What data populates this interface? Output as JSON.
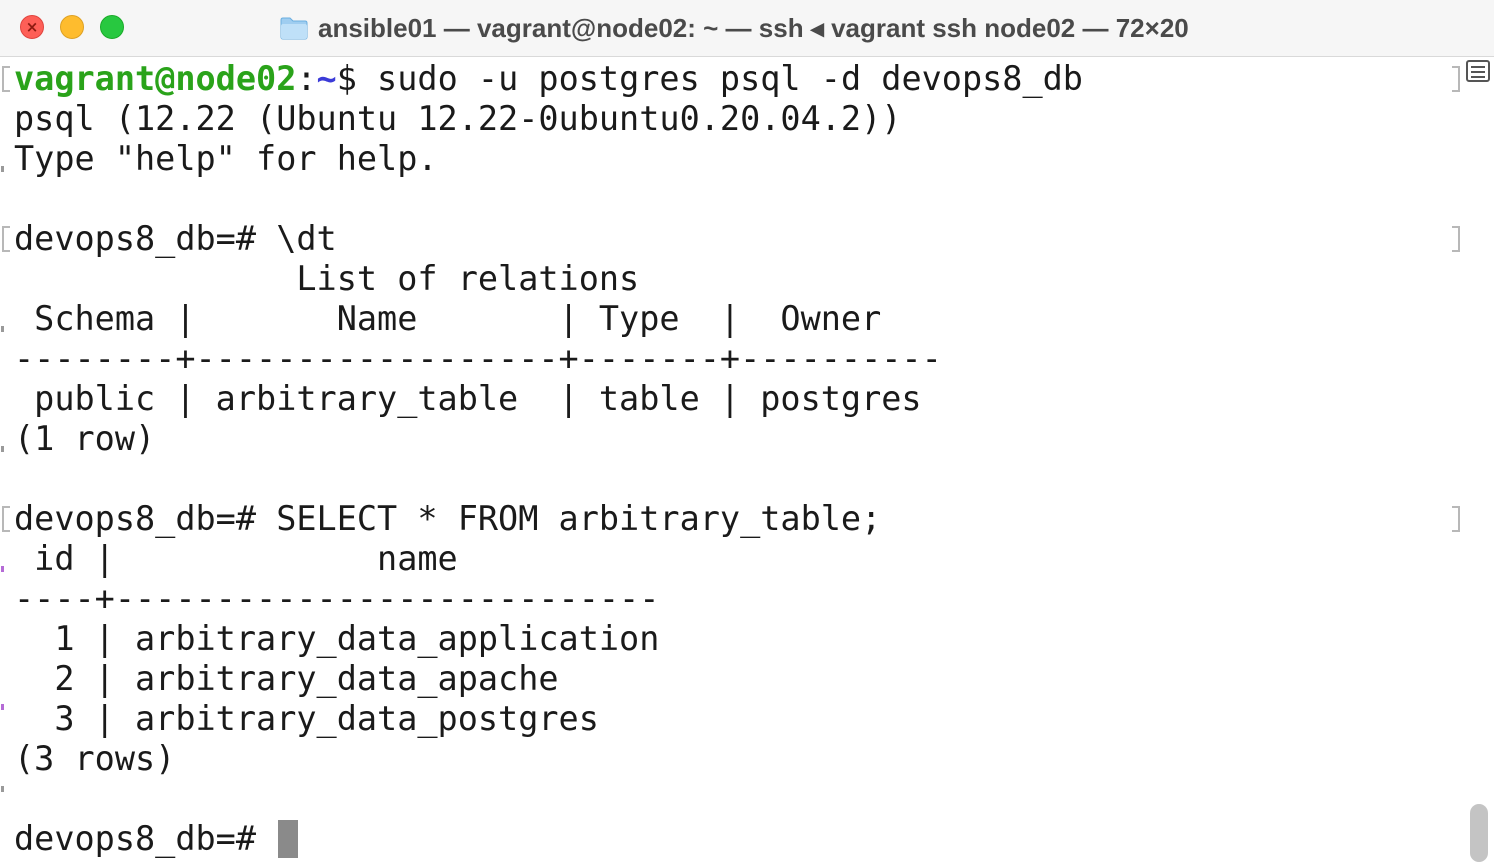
{
  "window": {
    "title": "ansible01 — vagrant@node02: ~ — ssh ◂ vagrant ssh node02 — 72×20",
    "icons": {
      "close": "close-icon",
      "folder": "folder-icon",
      "sidebar": "sidebar-toggle-icon"
    }
  },
  "terminal": {
    "prompt_user": "vagrant@node02",
    "prompt_sep": ":",
    "prompt_path": "~",
    "prompt_dollar": "$",
    "lines": [
      " sudo -u postgres psql -d devops8_db",
      "psql (12.22 (Ubuntu 12.22-0ubuntu0.20.04.2))",
      "Type \"help\" for help.",
      "",
      "devops8_db=# \\dt",
      "              List of relations",
      " Schema |       Name       | Type  |  Owner",
      "--------+------------------+-------+----------",
      " public | arbitrary_table  | table | postgres",
      "(1 row)",
      "",
      "devops8_db=# SELECT * FROM arbitrary_table;",
      " id |             name",
      "----+---------------------------",
      "  1 | arbitrary_data_application",
      "  2 | arbitrary_data_apache",
      "  3 | arbitrary_data_postgres",
      "(3 rows)",
      "",
      "devops8_db=# "
    ]
  }
}
